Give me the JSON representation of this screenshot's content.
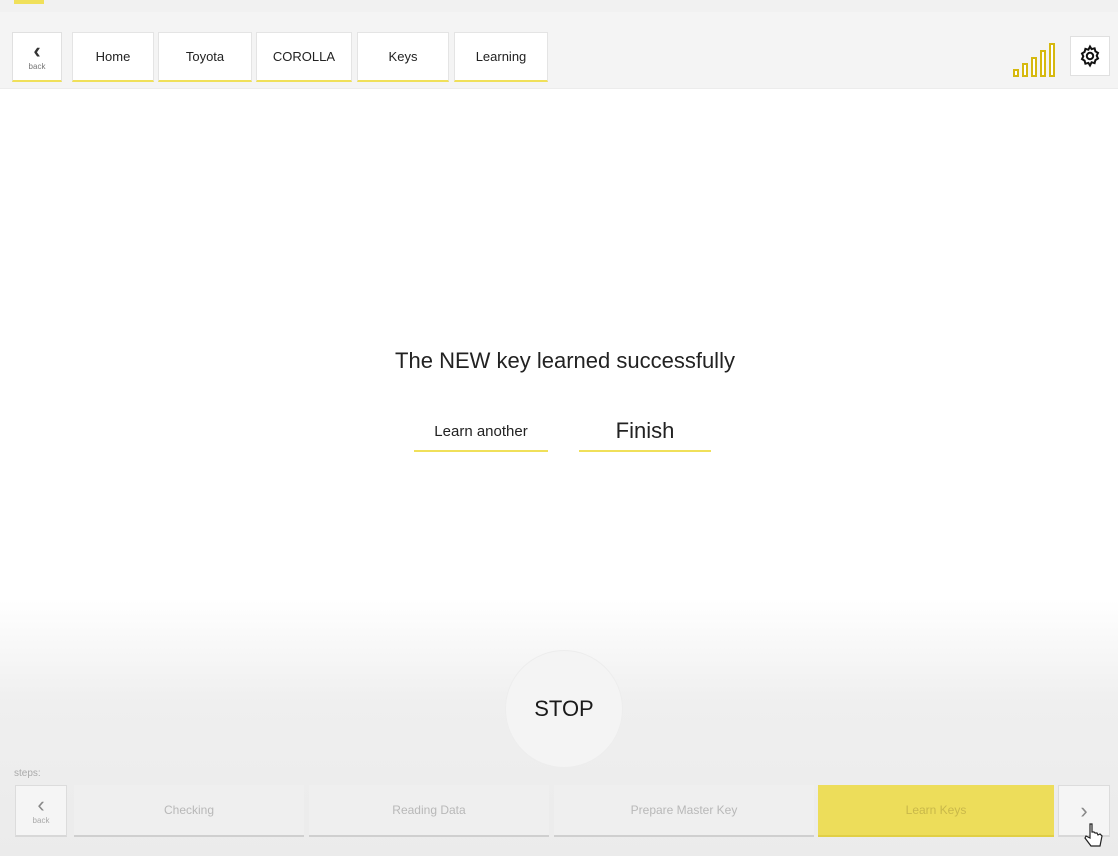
{
  "header": {
    "back_label": "back",
    "breadcrumbs": [
      "Home",
      "Toyota",
      "COROLLA",
      "Keys",
      "Learning"
    ],
    "icons": {
      "back": "chevron-left-icon",
      "signal": "signal-strength-icon",
      "settings": "gear-icon"
    }
  },
  "main": {
    "message": "The NEW key learned successfully",
    "learn_another_label": "Learn another",
    "finish_label": "Finish",
    "stop_label": "STOP"
  },
  "steps": {
    "label": "steps:",
    "back_label": "back",
    "items": [
      {
        "label": "Checking",
        "active": false
      },
      {
        "label": "Reading Data",
        "active": false
      },
      {
        "label": "Prepare Master Key",
        "active": false
      },
      {
        "label": "Learn Keys",
        "active": true
      }
    ]
  },
  "colors": {
    "accent": "#f0e05a",
    "active_step": "#eddd5a",
    "signal": "#d6b90f"
  }
}
